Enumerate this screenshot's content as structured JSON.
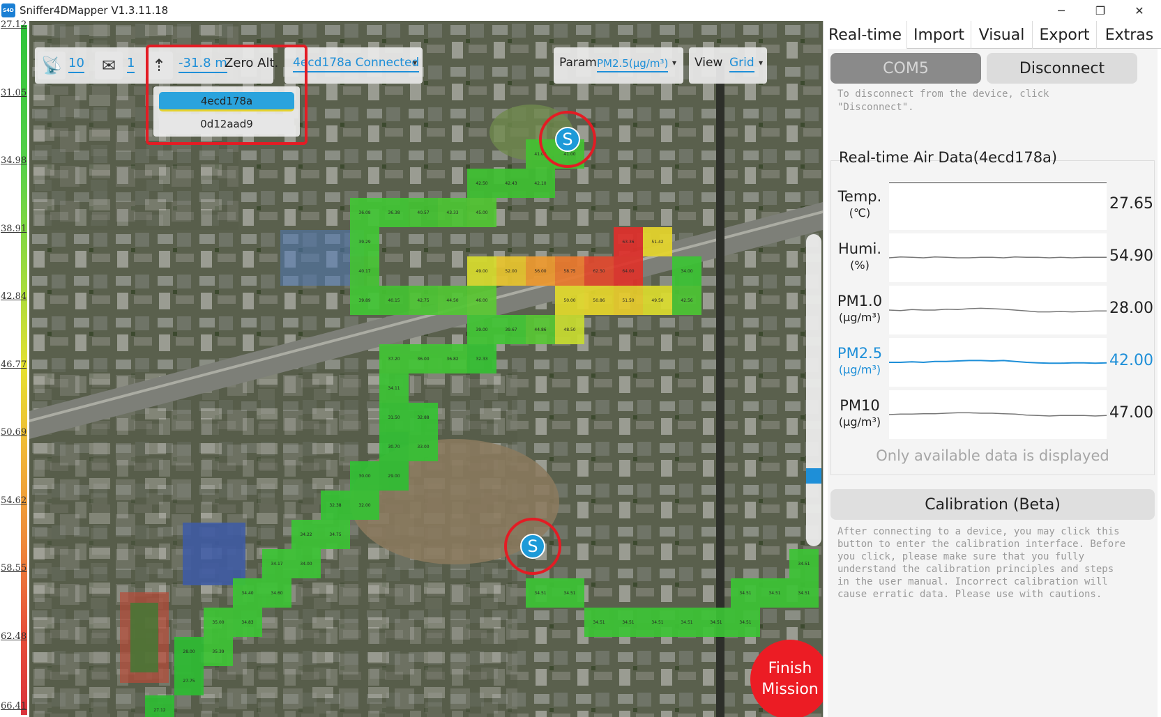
{
  "window": {
    "icon_text": "S4D",
    "title": "Sniffer4DMapper V1.3.11.18",
    "minimize": "─",
    "maximize": "❐",
    "close": "✕"
  },
  "scale": {
    "labels": [
      "27.12",
      "31.05",
      "34.98",
      "38.91",
      "42.84",
      "46.77",
      "50.69",
      "54.62",
      "58.55",
      "62.48",
      "66.41"
    ]
  },
  "toolbar": {
    "satellites": "10",
    "signal": "1",
    "altitude": "-31.8 m",
    "zero_alt": "Zero Alt.",
    "device_status": "4ecd178a Connected",
    "param_label": "Param",
    "param_value": "PM2.5(μg/m³)",
    "view_label": "View",
    "view_value": "Grid",
    "caret": "▾"
  },
  "device_dropdown": {
    "items": [
      "4ecd178a",
      "0d12aad9"
    ],
    "selected": "4ecd178a"
  },
  "markers": {
    "start_letter": "S"
  },
  "finish_button": {
    "line1": "Finish",
    "line2": "Mission"
  },
  "grid": [
    {
      "c": 17,
      "r": 4,
      "v": "41.00",
      "col": "#44c232"
    },
    {
      "c": 18,
      "r": 4,
      "v": "41.00",
      "col": "#44c232"
    },
    {
      "c": 15,
      "r": 5,
      "v": "42.50",
      "col": "#3ec031"
    },
    {
      "c": 16,
      "r": 5,
      "v": "42.43",
      "col": "#3ec031"
    },
    {
      "c": 17,
      "r": 5,
      "v": "42.10",
      "col": "#3ec031"
    },
    {
      "c": 11,
      "r": 6,
      "v": "36.08",
      "col": "#42c635"
    },
    {
      "c": 12,
      "r": 6,
      "v": "36.38",
      "col": "#42c635"
    },
    {
      "c": 13,
      "r": 6,
      "v": "40.57",
      "col": "#44c232"
    },
    {
      "c": 14,
      "r": 6,
      "v": "43.33",
      "col": "#4cc533"
    },
    {
      "c": 15,
      "r": 6,
      "v": "45.00",
      "col": "#52c734"
    },
    {
      "c": 11,
      "r": 7,
      "v": "39.29",
      "col": "#42c635"
    },
    {
      "c": 20,
      "r": 7,
      "v": "63.36",
      "col": "#e0302c"
    },
    {
      "c": 21,
      "r": 7,
      "v": "51.42",
      "col": "#e6d62c"
    },
    {
      "c": 11,
      "r": 8,
      "v": "40.17",
      "col": "#44c232"
    },
    {
      "c": 15,
      "r": 8,
      "v": "49.00",
      "col": "#d8dc2e"
    },
    {
      "c": 16,
      "r": 8,
      "v": "52.00",
      "col": "#e8c42e"
    },
    {
      "c": 17,
      "r": 8,
      "v": "56.00",
      "col": "#ee9a30"
    },
    {
      "c": 18,
      "r": 8,
      "v": "58.75",
      "col": "#ea7a2e"
    },
    {
      "c": 19,
      "r": 8,
      "v": "62.50",
      "col": "#e0482c"
    },
    {
      "c": 20,
      "r": 8,
      "v": "64.00",
      "col": "#de322a"
    },
    {
      "c": 22,
      "r": 8,
      "v": "34.00",
      "col": "#3cc435"
    },
    {
      "c": 11,
      "r": 9,
      "v": "39.89",
      "col": "#42c635"
    },
    {
      "c": 12,
      "r": 9,
      "v": "40.15",
      "col": "#44c232"
    },
    {
      "c": 13,
      "r": 9,
      "v": "42.75",
      "col": "#4cc533"
    },
    {
      "c": 14,
      "r": 9,
      "v": "44.50",
      "col": "#52c734"
    },
    {
      "c": 15,
      "r": 9,
      "v": "46.00",
      "col": "#5cc934"
    },
    {
      "c": 18,
      "r": 9,
      "v": "50.00",
      "col": "#e2da2c"
    },
    {
      "c": 19,
      "r": 9,
      "v": "50.86",
      "col": "#e6d62c"
    },
    {
      "c": 20,
      "r": 9,
      "v": "51.50",
      "col": "#e8cc2c"
    },
    {
      "c": 21,
      "r": 9,
      "v": "49.50",
      "col": "#dcdc2e"
    },
    {
      "c": 22,
      "r": 9,
      "v": "42.56",
      "col": "#4cc533"
    },
    {
      "c": 15,
      "r": 10,
      "v": "39.00",
      "col": "#42c635"
    },
    {
      "c": 16,
      "r": 10,
      "v": "39.67",
      "col": "#42c635"
    },
    {
      "c": 17,
      "r": 10,
      "v": "44.86",
      "col": "#58c834"
    },
    {
      "c": 18,
      "r": 10,
      "v": "48.50",
      "col": "#c8dc30"
    },
    {
      "c": 12,
      "r": 11,
      "v": "37.20",
      "col": "#42c635"
    },
    {
      "c": 13,
      "r": 11,
      "v": "36.00",
      "col": "#42c635"
    },
    {
      "c": 14,
      "r": 11,
      "v": "36.82",
      "col": "#42c635"
    },
    {
      "c": 15,
      "r": 11,
      "v": "32.33",
      "col": "#36c234"
    },
    {
      "c": 12,
      "r": 12,
      "v": "34.11",
      "col": "#3cc435"
    },
    {
      "c": 12,
      "r": 13,
      "v": "31.50",
      "col": "#36c234"
    },
    {
      "c": 13,
      "r": 13,
      "v": "32.88",
      "col": "#36c234"
    },
    {
      "c": 12,
      "r": 14,
      "v": "30.70",
      "col": "#32c034"
    },
    {
      "c": 13,
      "r": 14,
      "v": "33.00",
      "col": "#36c234"
    },
    {
      "c": 11,
      "r": 15,
      "v": "30.00",
      "col": "#32c034"
    },
    {
      "c": 12,
      "r": 15,
      "v": "29.00",
      "col": "#30be33"
    },
    {
      "c": 10,
      "r": 16,
      "v": "32.38",
      "col": "#36c234"
    },
    {
      "c": 11,
      "r": 16,
      "v": "32.00",
      "col": "#36c234"
    },
    {
      "c": 9,
      "r": 17,
      "v": "34.22",
      "col": "#3cc435"
    },
    {
      "c": 10,
      "r": 17,
      "v": "34.75",
      "col": "#3cc435"
    },
    {
      "c": 8,
      "r": 18,
      "v": "34.17",
      "col": "#3cc435"
    },
    {
      "c": 9,
      "r": 18,
      "v": "34.00",
      "col": "#3cc435"
    },
    {
      "c": 7,
      "r": 19,
      "v": "34.40",
      "col": "#3cc435"
    },
    {
      "c": 8,
      "r": 19,
      "v": "34.60",
      "col": "#3cc435"
    },
    {
      "c": 6,
      "r": 20,
      "v": "35.00",
      "col": "#3ec435"
    },
    {
      "c": 7,
      "r": 20,
      "v": "34.83",
      "col": "#3cc435"
    },
    {
      "c": 5,
      "r": 21,
      "v": "28.00",
      "col": "#2ebc33"
    },
    {
      "c": 6,
      "r": 21,
      "v": "35.39",
      "col": "#3ec435"
    },
    {
      "c": 5,
      "r": 22,
      "v": "27.75",
      "col": "#2ebc33"
    },
    {
      "c": 4,
      "r": 23,
      "v": "27.12",
      "col": "#2ebc33"
    },
    {
      "c": 17,
      "r": 19,
      "v": "34.51",
      "col": "#3cc435"
    },
    {
      "c": 18,
      "r": 19,
      "v": "34.51",
      "col": "#3cc435"
    },
    {
      "c": 19,
      "r": 20,
      "v": "34.51",
      "col": "#3cc435"
    },
    {
      "c": 20,
      "r": 20,
      "v": "34.51",
      "col": "#3cc435"
    },
    {
      "c": 21,
      "r": 20,
      "v": "34.51",
      "col": "#3cc435"
    },
    {
      "c": 22,
      "r": 20,
      "v": "34.51",
      "col": "#3cc435"
    },
    {
      "c": 23,
      "r": 20,
      "v": "34.51",
      "col": "#3cc435"
    },
    {
      "c": 24,
      "r": 20,
      "v": "34.51",
      "col": "#3cc435"
    },
    {
      "c": 24,
      "r": 19,
      "v": "34.51",
      "col": "#3cc435"
    },
    {
      "c": 25,
      "r": 19,
      "v": "34.51",
      "col": "#3cc435"
    },
    {
      "c": 26,
      "r": 19,
      "v": "34.51",
      "col": "#3cc435"
    },
    {
      "c": 26,
      "r": 18,
      "v": "34.51",
      "col": "#3cc435"
    }
  ],
  "panel": {
    "tabs": [
      "Real-time",
      "Import",
      "Visual",
      "Export",
      "Extras"
    ],
    "active_tab": "Real-time",
    "com_button": "COM5",
    "disconnect_button": "Disconnect",
    "disconnect_hint_1": "To disconnect from the device, click",
    "disconnect_hint_2": "\"Disconnect\".",
    "rt_title": "Real-time Air Data(4ecd178a)",
    "rows": [
      {
        "label": "Temp.",
        "unit": "(℃)",
        "value": "27.65",
        "color": "#222222",
        "series": [
          100,
          100,
          100,
          100,
          100,
          100,
          100,
          100,
          100,
          100,
          100,
          100,
          100,
          100,
          100,
          100,
          100,
          100,
          100,
          100
        ]
      },
      {
        "label": "Humi.",
        "unit": "(%)",
        "value": "54.90",
        "color": "#222222",
        "series": [
          50,
          52,
          51,
          50,
          52,
          51,
          50,
          50,
          51,
          51,
          50,
          52,
          51,
          51,
          50,
          51,
          50,
          51,
          51,
          51
        ]
      },
      {
        "label": "PM1.0",
        "unit": "(μg/m³)",
        "value": "28.00",
        "color": "#222222",
        "series": [
          50,
          49,
          51,
          50,
          50,
          52,
          51,
          53,
          54,
          53,
          52,
          50,
          48,
          46,
          46,
          47,
          46,
          47,
          48,
          48
        ]
      },
      {
        "label": "PM2.5",
        "unit": "(μg/m³)",
        "value": "42.00",
        "color": "#1e8fd8",
        "series": [
          50,
          50,
          51,
          50,
          52,
          52,
          53,
          54,
          54,
          53,
          54,
          52,
          50,
          49,
          48,
          48,
          49,
          49,
          48,
          49
        ]
      },
      {
        "label": "PM10",
        "unit": "(μg/m³)",
        "value": "47.00",
        "color": "#222222",
        "series": [
          50,
          51,
          51,
          52,
          52,
          53,
          54,
          54,
          53,
          53,
          52,
          51,
          49,
          48,
          47,
          48,
          48,
          48,
          47,
          48
        ]
      }
    ],
    "footnote": "Only available data is displayed",
    "calibration_title": "Calibration (Beta)",
    "calibration_hint": [
      "After connecting to a device, you may click this",
      "button to enter the calibration interface. Before",
      "you click, please make sure that you fully",
      "understand the calibration principles and steps",
      "in the user manual. Incorrect calibration will",
      "cause erratic data. Please use with cautions."
    ]
  }
}
